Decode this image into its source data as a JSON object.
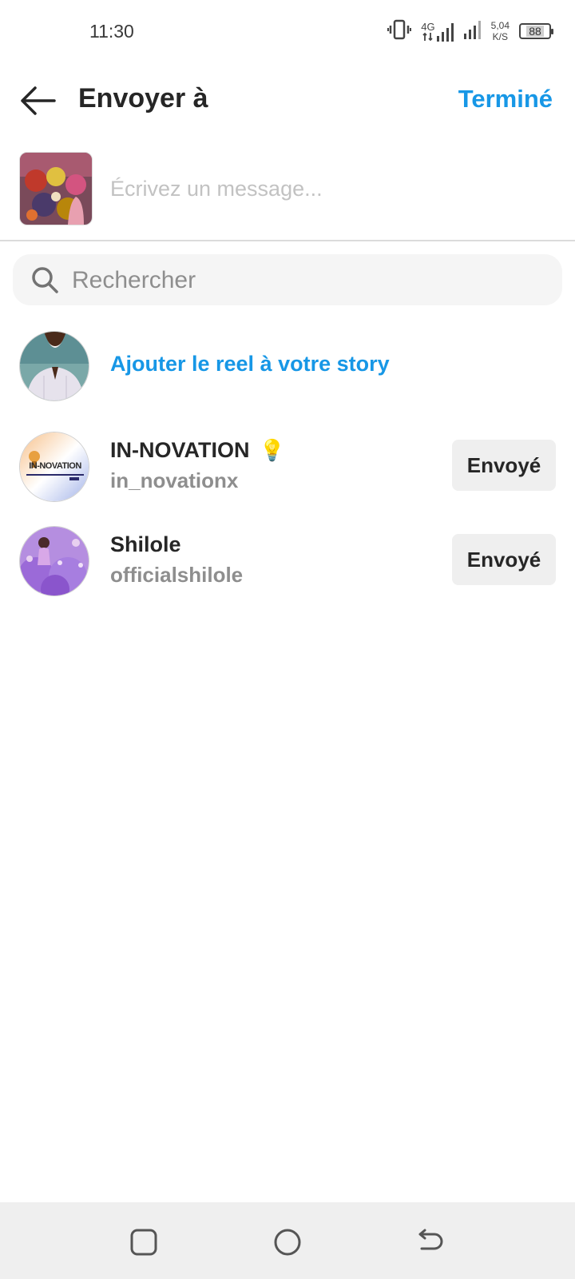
{
  "status_bar": {
    "time": "11:30",
    "network": "4G",
    "speed_value": "5,04",
    "speed_unit": "K/S",
    "battery": "88"
  },
  "header": {
    "title": "Envoyer à",
    "done_label": "Terminé"
  },
  "compose": {
    "message_placeholder": "Écrivez un message..."
  },
  "search": {
    "placeholder": "Rechercher"
  },
  "story": {
    "label": "Ajouter le reel à votre story"
  },
  "contacts": [
    {
      "name": "IN-NOVATION",
      "emoji": "💡",
      "username": "in_novationx",
      "button_label": "Envoyé",
      "avatar_text": "IN-NOVATION"
    },
    {
      "name": "Shilole",
      "username": "officialshilole",
      "button_label": "Envoyé"
    }
  ],
  "colors": {
    "accent": "#1797e6",
    "muted_text": "#8e8e8e",
    "button_bg": "#efefef"
  }
}
